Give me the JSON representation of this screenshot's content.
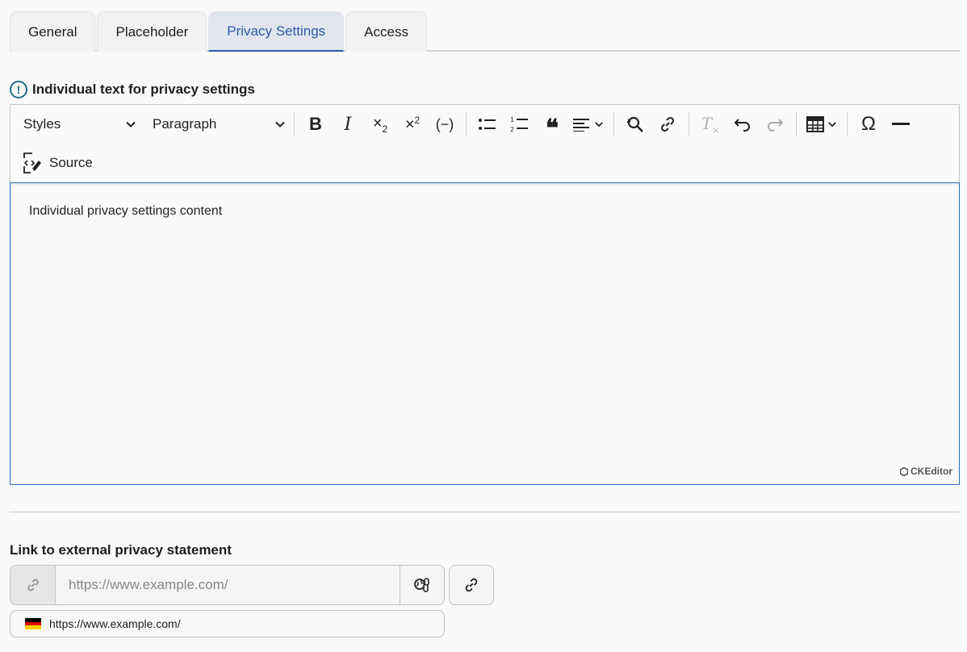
{
  "tabs": [
    {
      "label": "General"
    },
    {
      "label": "Placeholder"
    },
    {
      "label": "Privacy Settings"
    },
    {
      "label": "Access"
    }
  ],
  "editor_field": {
    "label": "Individual text for privacy settings",
    "content": "Individual privacy settings content",
    "brand": "CKEditor"
  },
  "toolbar": {
    "styles_label": "Styles",
    "paragraph_label": "Paragraph",
    "source_label": "Source"
  },
  "external_link": {
    "label": "Link to external privacy statement",
    "placeholder": "https://www.example.com/",
    "language_value": "https://www.example.com/"
  },
  "colors": {
    "accent": "#2a5ba4",
    "info_icon": "#1f6b8a",
    "focus_border": "#2f6ec2"
  }
}
